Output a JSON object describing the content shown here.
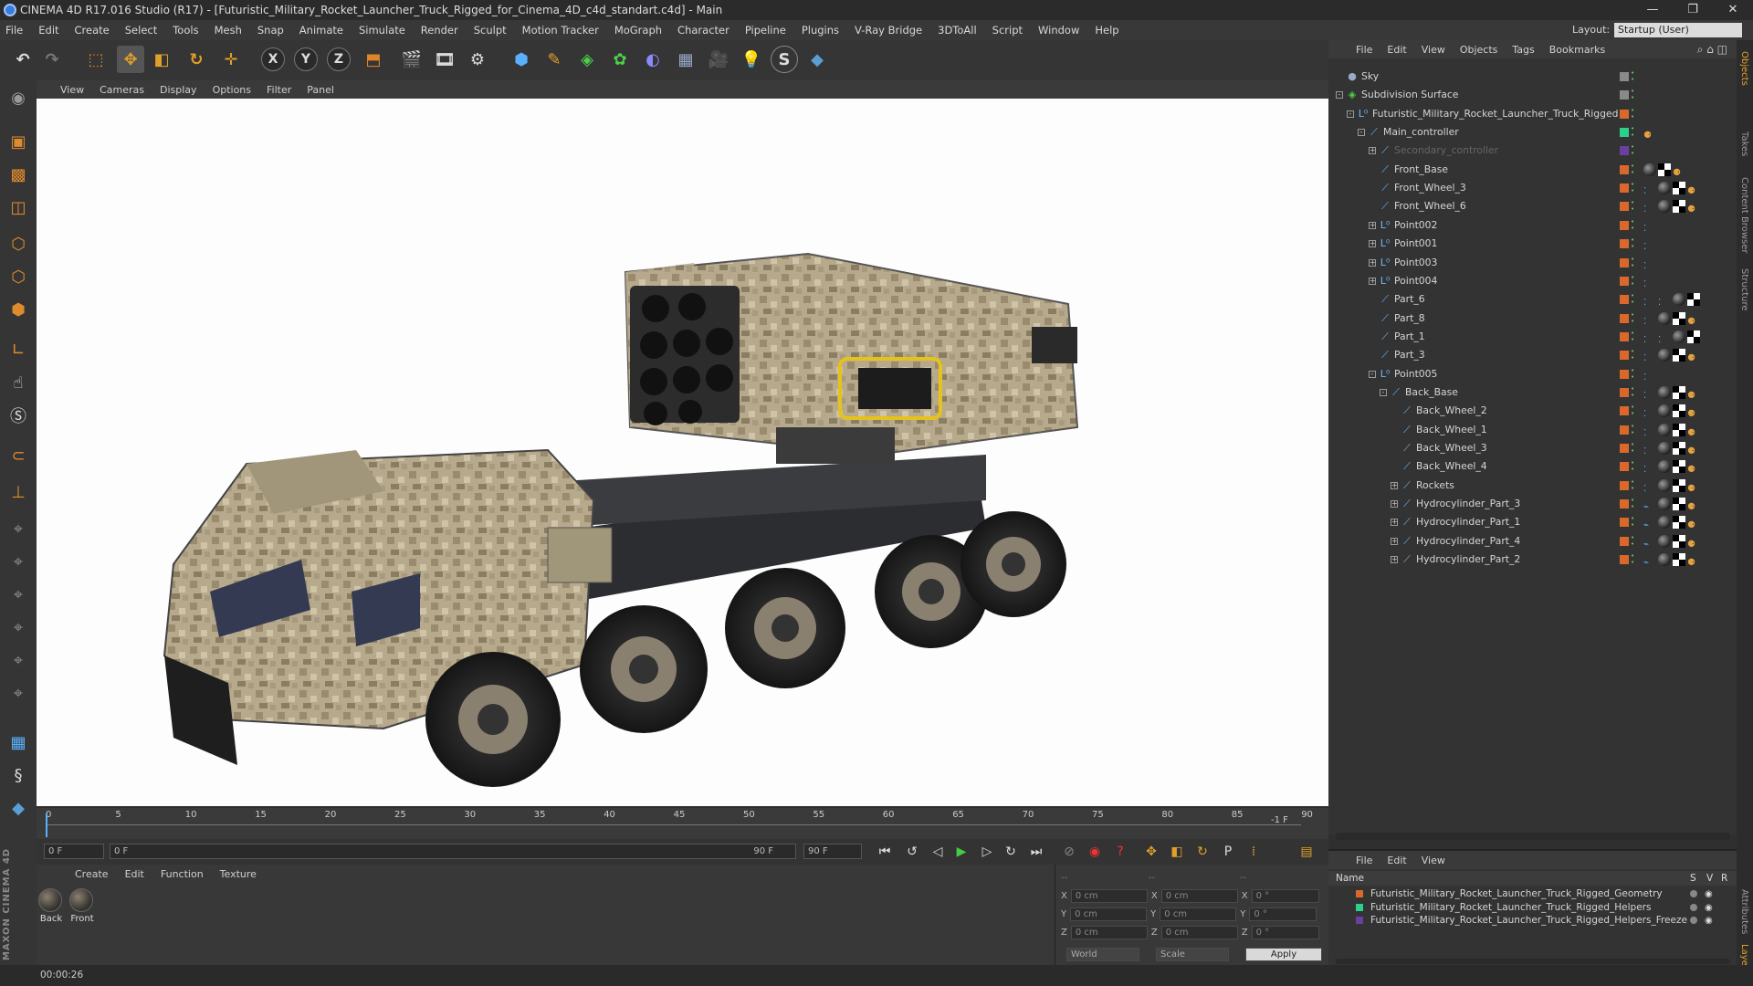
{
  "window": {
    "title": "CINEMA 4D R17.016 Studio (R17) - [Futuristic_Military_Rocket_Launcher_Truck_Rigged_for_Cinema_4D_c4d_standart.c4d] - Main",
    "minimize": "—",
    "maximize": "❐",
    "close": "✕"
  },
  "menubar": [
    "File",
    "Edit",
    "Create",
    "Select",
    "Tools",
    "Mesh",
    "Snap",
    "Animate",
    "Simulate",
    "Render",
    "Sculpt",
    "Motion Tracker",
    "MoGraph",
    "Character",
    "Pipeline",
    "Plugins",
    "V-Ray Bridge",
    "3DToAll",
    "Script",
    "Window",
    "Help"
  ],
  "layout": {
    "label": "Layout:",
    "value": "Startup (User)"
  },
  "toolbar": {
    "axis_x": "X",
    "axis_y": "Y",
    "axis_z": "Z"
  },
  "viewport": {
    "menu": [
      "View",
      "Cameras",
      "Display",
      "Options",
      "Filter",
      "Panel"
    ]
  },
  "timeline": {
    "ticks": [
      "0",
      "5",
      "10",
      "15",
      "20",
      "25",
      "30",
      "35",
      "40",
      "45",
      "50",
      "55",
      "60",
      "65",
      "70",
      "75",
      "80",
      "85",
      "90"
    ],
    "frame_indicator": "-1 F"
  },
  "transport": {
    "current_frame": "0 F",
    "range_start": "0 F",
    "range_end": "90 F",
    "end_frame": "90 F"
  },
  "material_manager": {
    "menu": [
      "Create",
      "Edit",
      "Function",
      "Texture"
    ],
    "materials": [
      "Back",
      "Front"
    ]
  },
  "coordinates": {
    "headers": [
      "--",
      "--",
      "--"
    ],
    "rows": [
      {
        "axis": "X",
        "pos": "0 cm",
        "size": "0 cm",
        "rot_axis": "X",
        "rot": "0 °"
      },
      {
        "axis": "Y",
        "pos": "0 cm",
        "size": "0 cm",
        "rot_axis": "Y",
        "rot": "0 °"
      },
      {
        "axis": "Z",
        "pos": "0 cm",
        "size": "0 cm",
        "rot_axis": "Z",
        "rot": "0 °"
      }
    ],
    "mode": "World",
    "mode2": "Scale",
    "apply": "Apply"
  },
  "object_manager": {
    "menu": [
      "File",
      "Edit",
      "View",
      "Objects",
      "Tags",
      "Bookmarks"
    ],
    "objects": [
      {
        "name": "Sky",
        "depth": 0,
        "icon": "sky",
        "expand": "",
        "color": "#8a8a8a",
        "tags": []
      },
      {
        "name": "Subdivision Surface",
        "depth": 0,
        "icon": "subd",
        "expand": "-",
        "color": "#8a8a8a",
        "tags": []
      },
      {
        "name": "Futuristic_Military_Rocket_Launcher_Truck_Rigged",
        "depth": 1,
        "icon": "null",
        "expand": "-",
        "color": "#d9682a",
        "tags": []
      },
      {
        "name": "Main_controller",
        "depth": 2,
        "icon": "joint",
        "expand": "-",
        "color": "#2bd18a",
        "tags": [
          "o"
        ]
      },
      {
        "name": "Secondary_controller",
        "depth": 3,
        "icon": "joint",
        "expand": "+",
        "color": "#6a3fa0",
        "tags": [],
        "dim": true
      },
      {
        "name": "Front_Base",
        "depth": 3,
        "icon": "joint",
        "expand": "",
        "color": "#d9682a",
        "tags": [
          "m",
          "c",
          "o"
        ]
      },
      {
        "name": "Front_Wheel_3",
        "depth": 3,
        "icon": "joint",
        "expand": "",
        "color": "#d9682a",
        "tags": [
          "d",
          "m",
          "c",
          "o"
        ]
      },
      {
        "name": "Front_Wheel_6",
        "depth": 3,
        "icon": "joint",
        "expand": "",
        "color": "#d9682a",
        "tags": [
          "d",
          "m",
          "c",
          "o"
        ]
      },
      {
        "name": "Point002",
        "depth": 3,
        "icon": "null",
        "expand": "+",
        "color": "#d9682a",
        "tags": [
          "d"
        ]
      },
      {
        "name": "Point001",
        "depth": 3,
        "icon": "null",
        "expand": "+",
        "color": "#d9682a",
        "tags": [
          "d"
        ]
      },
      {
        "name": "Point003",
        "depth": 3,
        "icon": "null",
        "expand": "+",
        "color": "#d9682a",
        "tags": [
          "d"
        ]
      },
      {
        "name": "Point004",
        "depth": 3,
        "icon": "null",
        "expand": "+",
        "color": "#d9682a",
        "tags": [
          "d"
        ]
      },
      {
        "name": "Part_6",
        "depth": 3,
        "icon": "joint",
        "expand": "",
        "color": "#d9682a",
        "tags": [
          "d",
          "d",
          "m",
          "c"
        ]
      },
      {
        "name": "Part_8",
        "depth": 3,
        "icon": "joint",
        "expand": "",
        "color": "#d9682a",
        "tags": [
          "d",
          "m",
          "c",
          "o"
        ]
      },
      {
        "name": "Part_1",
        "depth": 3,
        "icon": "joint",
        "expand": "",
        "color": "#d9682a",
        "tags": [
          "d",
          "d",
          "m",
          "c"
        ]
      },
      {
        "name": "Part_3",
        "depth": 3,
        "icon": "joint",
        "expand": "",
        "color": "#d9682a",
        "tags": [
          "d",
          "m",
          "c",
          "o"
        ]
      },
      {
        "name": "Point005",
        "depth": 3,
        "icon": "null",
        "expand": "-",
        "color": "#d9682a",
        "tags": [
          "d"
        ]
      },
      {
        "name": "Back_Base",
        "depth": 4,
        "icon": "joint",
        "expand": "-",
        "color": "#d9682a",
        "tags": [
          "d",
          "m",
          "c",
          "o"
        ]
      },
      {
        "name": "Back_Wheel_2",
        "depth": 5,
        "icon": "joint",
        "expand": "",
        "color": "#d9682a",
        "tags": [
          "d",
          "m",
          "c",
          "o"
        ]
      },
      {
        "name": "Back_Wheel_1",
        "depth": 5,
        "icon": "joint",
        "expand": "",
        "color": "#d9682a",
        "tags": [
          "d",
          "m",
          "c",
          "o"
        ]
      },
      {
        "name": "Back_Wheel_3",
        "depth": 5,
        "icon": "joint",
        "expand": "",
        "color": "#d9682a",
        "tags": [
          "d",
          "m",
          "c",
          "o"
        ]
      },
      {
        "name": "Back_Wheel_4",
        "depth": 5,
        "icon": "joint",
        "expand": "",
        "color": "#d9682a",
        "tags": [
          "d",
          "m",
          "c",
          "o"
        ]
      },
      {
        "name": "Rockets",
        "depth": 5,
        "icon": "joint",
        "expand": "+",
        "color": "#d9682a",
        "tags": [
          "d",
          "m",
          "c",
          "o"
        ]
      },
      {
        "name": "Hydrocylinder_Part_3",
        "depth": 5,
        "icon": "joint",
        "expand": "+",
        "color": "#d9682a",
        "tags": [
          "k",
          "m",
          "c",
          "o"
        ]
      },
      {
        "name": "Hydrocylinder_Part_1",
        "depth": 5,
        "icon": "joint",
        "expand": "+",
        "color": "#d9682a",
        "tags": [
          "k",
          "m",
          "c",
          "o"
        ]
      },
      {
        "name": "Hydrocylinder_Part_4",
        "depth": 5,
        "icon": "joint",
        "expand": "+",
        "color": "#d9682a",
        "tags": [
          "k",
          "m",
          "c",
          "o"
        ]
      },
      {
        "name": "Hydrocylinder_Part_2",
        "depth": 5,
        "icon": "joint",
        "expand": "+",
        "color": "#d9682a",
        "tags": [
          "k",
          "m",
          "c",
          "o"
        ]
      }
    ]
  },
  "layer_manager": {
    "menu": [
      "File",
      "Edit",
      "View"
    ],
    "header": {
      "name": "Name",
      "s": "S",
      "v": "V",
      "r": "R"
    },
    "layers": [
      {
        "name": "Futuristic_Military_Rocket_Launcher_Truck_Rigged_Geometry",
        "color": "#d9682a"
      },
      {
        "name": "Futuristic_Military_Rocket_Launcher_Truck_Rigged_Helpers",
        "color": "#2bd18a"
      },
      {
        "name": "Futuristic_Military_Rocket_Launcher_Truck_Rigged_Helpers_Freeze",
        "color": "#6a3fa0"
      }
    ]
  },
  "right_tabs": [
    "Objects",
    "Takes",
    "Content Browser",
    "Structure",
    "Attributes",
    "Layers"
  ],
  "maxon_logo": "MAXON CINEMA 4D",
  "status": {
    "time": "00:00:26"
  }
}
